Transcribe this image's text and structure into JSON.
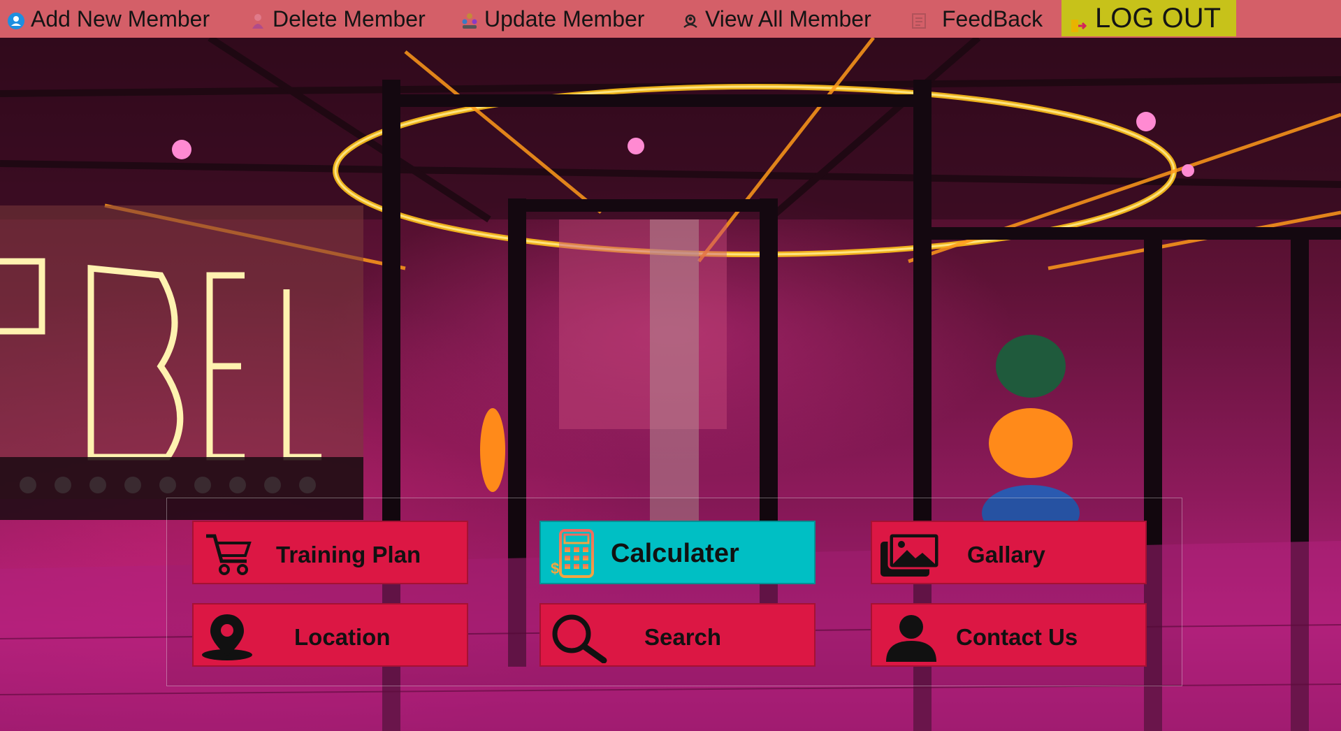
{
  "menu": {
    "items": [
      {
        "label": "Add New Member",
        "icon": "add-user-icon"
      },
      {
        "label": "Delete Member",
        "icon": "delete-user-icon"
      },
      {
        "label": "Update Member",
        "icon": "update-users-icon"
      },
      {
        "label": "View All Member",
        "icon": "view-members-icon"
      },
      {
        "label": "FeedBack",
        "icon": "feedback-icon"
      }
    ],
    "logout_label": "LOG OUT"
  },
  "buttons": [
    {
      "label": "Training Plan",
      "icon": "cart-icon"
    },
    {
      "label": "Calculater",
      "icon": "calculator-icon",
      "active": true
    },
    {
      "label": "Gallary",
      "icon": "gallery-icon"
    },
    {
      "label": "Location",
      "icon": "location-pin-icon"
    },
    {
      "label": "Search",
      "icon": "search-icon"
    },
    {
      "label": "Contact Us",
      "icon": "contact-person-icon"
    }
  ],
  "colors": {
    "menubar": "#d45f68",
    "logout": "#c7c21a",
    "button": "#dc1744",
    "button_active": "#00bfc4"
  }
}
